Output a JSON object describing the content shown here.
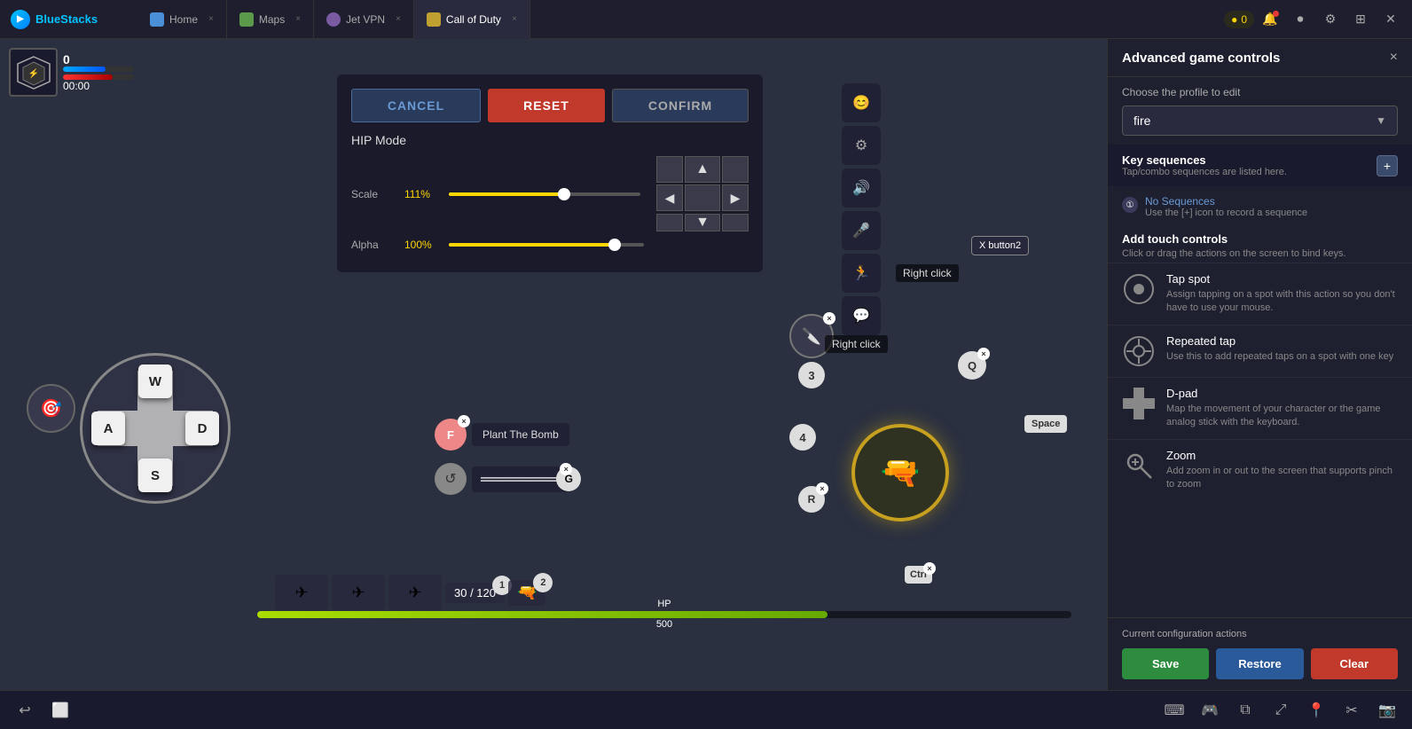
{
  "app": {
    "name": "BlueStacks",
    "tabs": [
      {
        "id": "home",
        "label": "Home",
        "icon": "home",
        "active": false
      },
      {
        "id": "maps",
        "label": "Maps",
        "icon": "maps",
        "active": false
      },
      {
        "id": "jetvpn",
        "label": "Jet VPN",
        "icon": "vpn",
        "active": false
      },
      {
        "id": "cod",
        "label": "Call of Duty",
        "icon": "cod",
        "active": true
      }
    ],
    "coin_count": "0",
    "window_controls": [
      "minimize",
      "restore",
      "close"
    ]
  },
  "hud": {
    "score": "0",
    "timer": "00:00"
  },
  "popup": {
    "cancel_label": "CANCEL",
    "reset_label": "RESET",
    "confirm_label": "CONFIRM",
    "mode_title": "HIP Mode",
    "scale_label": "Scale",
    "scale_value": "111%",
    "alpha_label": "Alpha",
    "alpha_value": "100%"
  },
  "game_keys": {
    "w": "W",
    "a": "A",
    "s": "S",
    "d": "D",
    "f_key": "F",
    "g_key": "G",
    "r_key": "R",
    "q_key": "Q",
    "ctrl_key": "Ctrl",
    "space_key": "Space",
    "num1": "1",
    "num2": "2",
    "num3": "3",
    "num4": "4",
    "right_click1": "Right click",
    "right_click2": "Right click",
    "x_button2": "X button2",
    "plant_bomb": "Plant The Bomb",
    "ammo": "30 / 120",
    "hp": "500"
  },
  "right_panel": {
    "title": "Advanced game controls",
    "close_label": "×",
    "profile_label": "Choose the profile to edit",
    "profile_value": "fire",
    "key_sequences": {
      "title": "Key sequences",
      "subtitle": "Tap/combo sequences are listed here.",
      "add_icon": "+",
      "no_seq_link": "No Sequences",
      "no_seq_desc": "Use the [+] icon to record a sequence"
    },
    "add_touch": {
      "title": "Add touch controls",
      "subtitle": "Click or drag the actions on the screen to bind keys."
    },
    "controls": [
      {
        "id": "tap-spot",
        "name": "Tap spot",
        "desc": "Assign tapping on a spot with this action so you don't have to use your mouse.",
        "icon": "tap"
      },
      {
        "id": "repeated-tap",
        "name": "Repeated tap",
        "desc": "Use this to add repeated taps on a spot with one key",
        "icon": "repeated-tap"
      },
      {
        "id": "d-pad",
        "name": "D-pad",
        "desc": "Map the movement of your character or the game analog stick with the keyboard.",
        "icon": "dpad"
      },
      {
        "id": "zoom",
        "name": "Zoom",
        "desc": "Add zoom in or out to the screen that supports pinch to zoom",
        "icon": "zoom"
      }
    ],
    "footer": {
      "section_label": "Current configuration actions",
      "save_label": "Save",
      "restore_label": "Restore",
      "clear_label": "Clear"
    }
  }
}
